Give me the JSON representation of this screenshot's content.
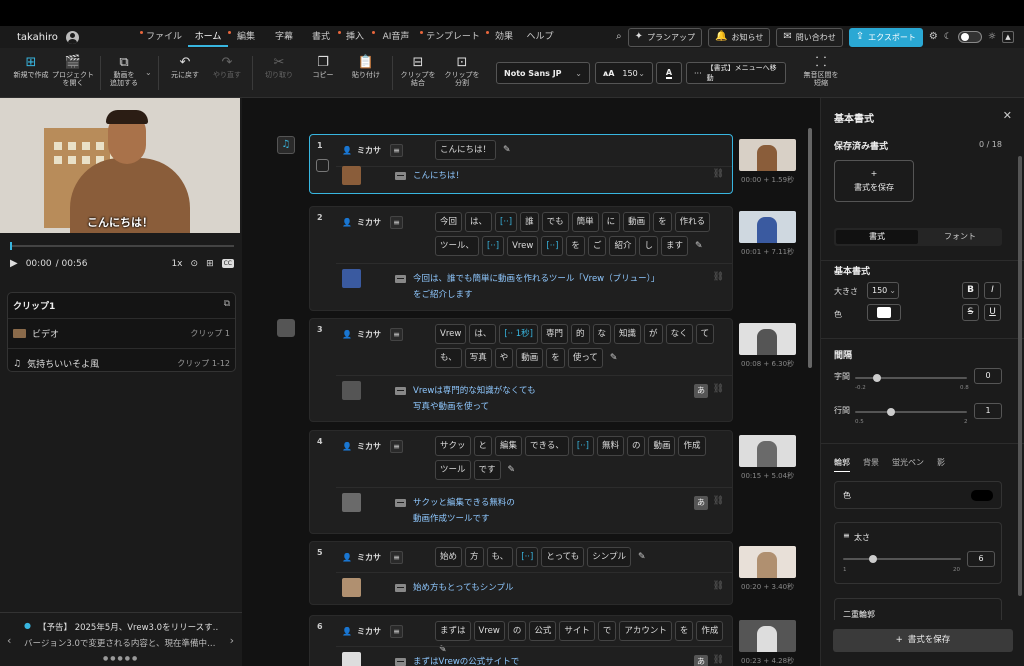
{
  "user": {
    "name": "takahiro"
  },
  "menu": {
    "tabs": [
      {
        "label": "ファイル",
        "dot": true
      },
      {
        "label": "ホーム",
        "dot": false,
        "active": true
      },
      {
        "label": "編集",
        "dot": true
      },
      {
        "label": "字幕",
        "dot": false
      },
      {
        "label": "書式",
        "dot": false
      },
      {
        "label": "挿入",
        "dot": true
      },
      {
        "label": "AI音声",
        "dot": true
      },
      {
        "label": "テンプレート",
        "dot": true
      },
      {
        "label": "効果",
        "dot": true
      },
      {
        "label": "ヘルプ",
        "dot": false
      }
    ],
    "plan_up": "プランアップ",
    "notice": "お知らせ",
    "contact": "問い合わせ",
    "export": "エクスポート"
  },
  "toolbar": {
    "new": "新規で作成",
    "open": "プロジェクト\nを開く",
    "add_video": "動画を\n追加する",
    "undo": "元に戻す",
    "redo": "やり直す",
    "cut": "切り取り",
    "copy": "コピー",
    "paste": "貼り付け",
    "merge": "クリップを\n結合",
    "split": "クリップを\n分割",
    "font": "Noto Sans JP",
    "size": "150",
    "goto": "【書式】メニューへ移動",
    "trim": "無音区間を\n短縮"
  },
  "player": {
    "caption": "こんにちは！",
    "time": "00:00",
    "duration": "/ 00:56",
    "speed": "1x"
  },
  "clips": {
    "title": "クリップ1",
    "rows": [
      {
        "label": "ビデオ",
        "meta": "クリップ 1"
      },
      {
        "label": "気持ちいいそよ風",
        "meta": "クリップ 1-12"
      }
    ]
  },
  "news": {
    "title": "【予告】 2025年5月、Vrew3.0をリリースす…",
    "body": "バージョン3.0で変更される内容と、現在準備中…"
  },
  "speaker": "ミカサ",
  "cards": [
    {
      "num": "1",
      "words": [
        "こんにちは！"
      ],
      "gaps": [],
      "sub": [
        "こんにちは！"
      ],
      "time": "00:00 + 1.59秒",
      "badge": false
    },
    {
      "num": "2",
      "words": [
        "今回",
        "は、",
        "[··]",
        "誰",
        "でも",
        "簡単",
        "に",
        "動画",
        "を",
        "作れる",
        "ツール、",
        "[··]",
        "Vrew",
        "[··]",
        "を",
        "ご",
        "紹介",
        "し",
        "ます"
      ],
      "gaps": [
        2,
        11,
        13
      ],
      "sub": [
        "今回は、誰でも簡単に動画を作れるツール「Vrew（ブリュー）」",
        "をご紹介します"
      ],
      "time": "00:01 + 7.11秒",
      "badge": false
    },
    {
      "num": "3",
      "words": [
        "Vrew",
        "は、",
        "[·· 1秒]",
        "専門",
        "的",
        "な",
        "知識",
        "が",
        "なく",
        "て",
        "も、",
        "写真",
        "や",
        "動画",
        "を",
        "使って"
      ],
      "gaps": [
        2
      ],
      "sub": [
        "Vrewは専門的な知識がなくても",
        "写真や動画を使って"
      ],
      "time": "00:08 + 6.30秒",
      "badge": true
    },
    {
      "num": "4",
      "words": [
        "サクッ",
        "と",
        "編集",
        "できる、",
        "[··]",
        "無料",
        "の",
        "動画",
        "作成",
        "ツール",
        "です"
      ],
      "gaps": [
        4
      ],
      "sub": [
        "サクッと編集できる無料の",
        "動画作成ツールです"
      ],
      "time": "00:15 + 5.04秒",
      "badge": true
    },
    {
      "num": "5",
      "words": [
        "始め",
        "方",
        "も、",
        "[··]",
        "とっても",
        "シンプル"
      ],
      "gaps": [
        3
      ],
      "sub": [
        "始め方もとってもシンプル"
      ],
      "time": "00:20 + 3.40秒",
      "badge": false
    },
    {
      "num": "6",
      "words": [
        "まずは",
        "Vrew",
        "の",
        "公式",
        "サイト",
        "で",
        "アカウント",
        "を",
        "作成"
      ],
      "gaps": [],
      "sub": [
        "まずはVrewの公式サイトで"
      ],
      "time": "00:23 + 4.28秒",
      "badge": true
    }
  ],
  "format": {
    "title": "基本書式",
    "saved": "保存済み書式",
    "saved_count": "0 / 18",
    "save_btn": "書式を保存",
    "tab_style": "書式",
    "tab_font": "フォント",
    "basic": "基本書式",
    "size_label": "大きさ",
    "size_value": "150",
    "color_label": "色",
    "spacing": "間隔",
    "char_spacing": "字間",
    "char_min": "-0.2",
    "char_max": "0.8",
    "char_val": "0",
    "line_spacing": "行間",
    "line_min": "0.5",
    "line_max": "2",
    "line_val": "1",
    "subtabs": [
      "輪郭",
      "背景",
      "蛍光ペン",
      "影"
    ],
    "outline_color": "色",
    "thickness": "太さ",
    "thick_min": "1",
    "thick_max": "20",
    "thick_val": "6",
    "double": "二重輪郭",
    "save_footer": "書式を保存"
  },
  "colors": {
    "accent": "#38b6e0",
    "subtitle": "#8fc8ff",
    "dot": "#e8663c"
  }
}
